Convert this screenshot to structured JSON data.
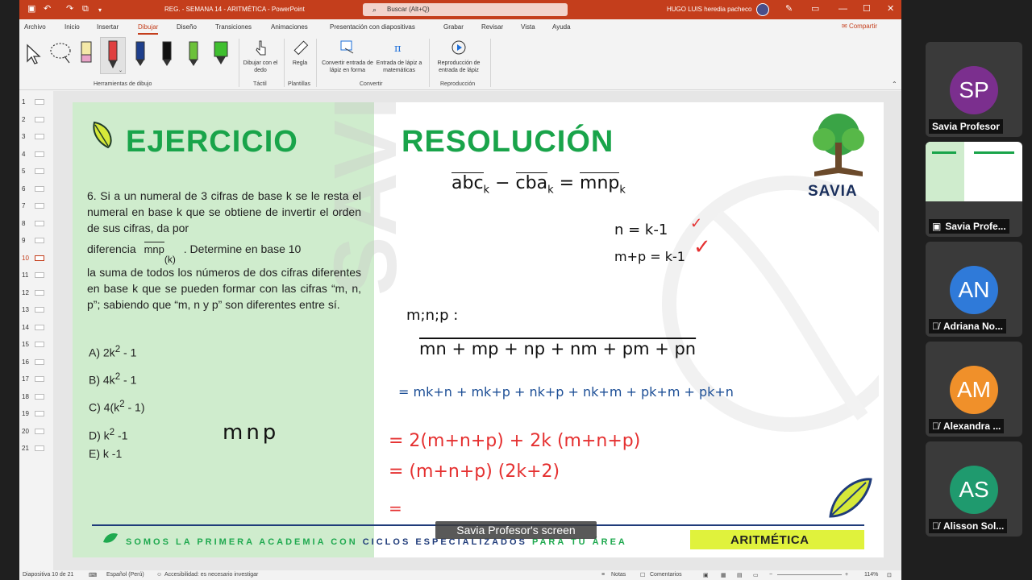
{
  "window": {
    "doc_title": "REG. - SEMANA 14 - ARITMÉTICA  -  PowerPoint",
    "search_placeholder": "Buscar (Alt+Q)",
    "user_name": "HUGO LUIS heredia pacheco"
  },
  "tabs": [
    "Archivo",
    "Inicio",
    "Insertar",
    "Dibujar",
    "Diseño",
    "Transiciones",
    "Animaciones",
    "Presentación con diapositivas",
    "Grabar",
    "Revisar",
    "Vista",
    "Ayuda"
  ],
  "active_tab": "Dibujar",
  "share_label": "Compartir",
  "ribbon": {
    "group_drawing_tools": "Herramientas de dibujo",
    "btn_draw_finger": "Dibujar con el dedo",
    "group_tactil": "Táctil",
    "btn_ruler": "Regla",
    "group_templates": "Plantillas",
    "btn_ink_to_shape": "Convertir entrada de lápiz en forma",
    "btn_ink_to_math": "Entrada de lápiz a matemáticas",
    "group_convert": "Convertir",
    "btn_ink_replay": "Reproducción de entrada de lápiz",
    "group_replay": "Reproducción",
    "pen_colors": [
      "#e04040",
      "#1e3f8c",
      "#111111",
      "#6cc13a",
      "#3fbf2f"
    ]
  },
  "slide_numbers": [
    "1",
    "2",
    "3",
    "4",
    "5",
    "6",
    "7",
    "8",
    "9",
    "10",
    "11",
    "12",
    "13",
    "14",
    "15",
    "16",
    "17",
    "18",
    "19",
    "20",
    "21"
  ],
  "active_slide": "10",
  "slide": {
    "title_left": "EJERCICIO",
    "title_right": "RESOLUCIÓN",
    "problem_text_1": "6.  Si a un numeral de 3 cifras de base k se le resta el numeral en base k que se obtiene de invertir el orden de sus cifras, da por",
    "problem_text_2a": "diferencia ",
    "problem_overline": "mnp",
    "problem_sub": "(k)",
    "problem_text_2b": ". Determine en base 10",
    "problem_text_3": " la suma de todos los números de dos cifras diferentes en base k que se pueden formar con las cifras “m, n, p”; sabiendo que “m, n y p” son diferentes entre sí.",
    "options": [
      {
        "letter": "A)",
        "text": "2k",
        "sup": "2",
        "rest": " - 1"
      },
      {
        "letter": "B)",
        "text": "4k",
        "sup": "2",
        "rest": " - 1"
      },
      {
        "letter": "C)",
        "text": "4(k",
        "sup": "2",
        "rest": " - 1)"
      },
      {
        "letter": "D)",
        "text": "k",
        "sup": "2",
        "rest": " -1"
      },
      {
        "letter": "E)",
        "text": "k -1",
        "sup": "",
        "rest": ""
      }
    ],
    "slogan_a": "SOMOS LA PRIMERA ACADEMIA CON ",
    "slogan_b": "CICLOS ESPECIALIZADOS",
    "slogan_c": " PARA TU ÁREA",
    "course": "ARITMÉTICA",
    "logo": "SAVIA",
    "ink": {
      "eq1_a": "abc",
      "eq1_b": "cba",
      "eq1_c": "mnp",
      "k": "k",
      "eq2": "n = k-1",
      "eq3": "m+p = k-1",
      "note1": "m;n;p :",
      "sum_line": "mn + mp + np + nm + pm + pn",
      "expand_line": "= mk+n + mk+p + nk+p + nk+m + pk+m + pk+n",
      "line_a": "= 2(m+n+p) + 2k (m+n+p)",
      "line_b": "= (m+n+p) (2k+2)",
      "line_c": "=",
      "scratch": "mnp"
    }
  },
  "screen_share_caption": "Savia Profesor's screen",
  "status": {
    "slide_pos": "Diapositiva 10 de 21",
    "language": "Español (Perú)",
    "accessibility": "Accesibilidad: es necesario investigar",
    "notes": "Notas",
    "comments": "Comentarios",
    "zoom": "114%"
  },
  "participants": [
    {
      "initials": "SP",
      "name": "Savia Profesor",
      "color": "#7b2f8e",
      "muted": false
    },
    {
      "initials": "",
      "name": "Savia Profe...",
      "color": "",
      "muted": false,
      "screen": true
    },
    {
      "initials": "AN",
      "name": "Adriana No...",
      "color": "#2f7ad9",
      "muted": true
    },
    {
      "initials": "AM",
      "name": "Alexandra ...",
      "color": "#f0902a",
      "muted": true
    },
    {
      "initials": "AS",
      "name": "Alisson Sol...",
      "color": "#1f9a6e",
      "muted": true
    }
  ]
}
